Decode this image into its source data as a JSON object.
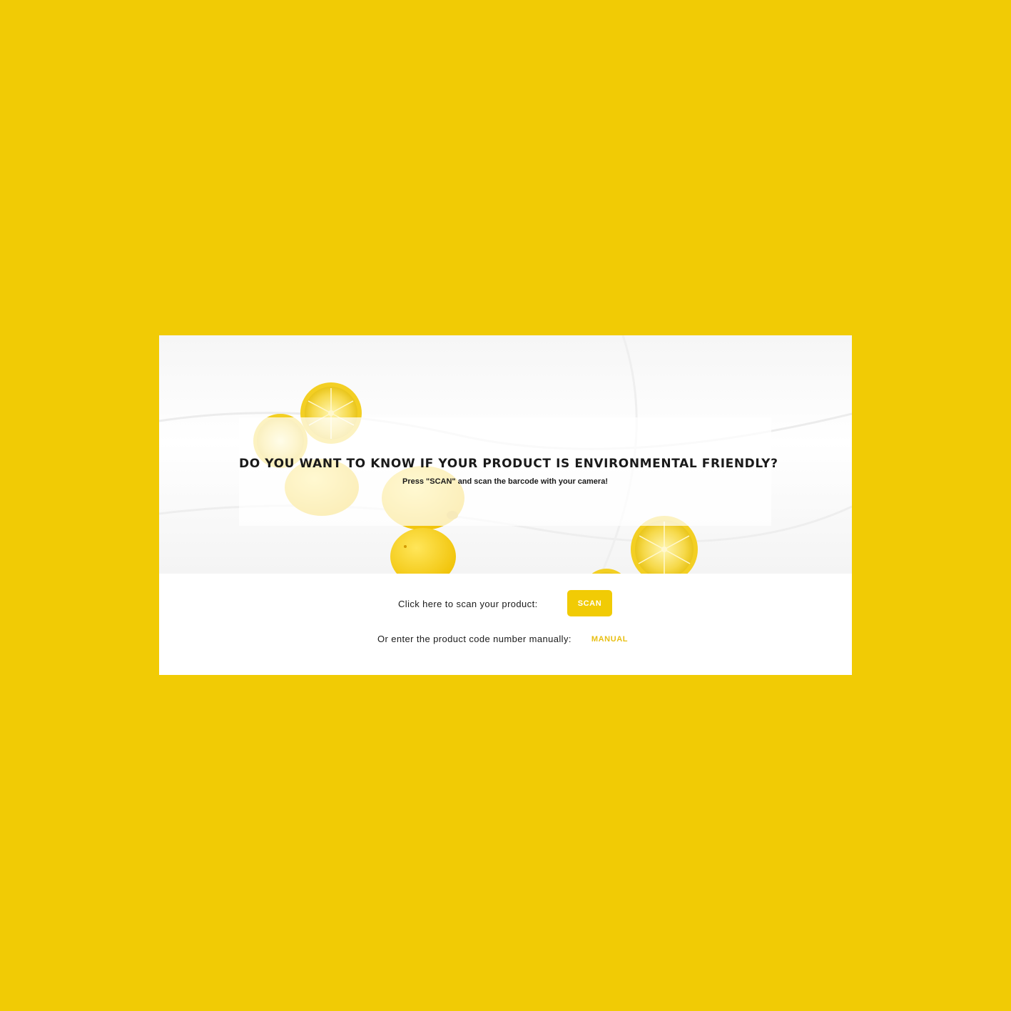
{
  "hero": {
    "title": "DO YOU WANT TO KNOW IF YOUR PRODUCT IS ENVIRONMENTAL FRIENDLY?",
    "subtitle": "Press \"SCAN\" and scan the barcode with your camera!"
  },
  "actions": {
    "scan_prompt": "Click here to scan your product:",
    "scan_label": "SCAN",
    "manual_prompt": "Or enter the product code number manually:",
    "manual_label": "MANUAL"
  },
  "colors": {
    "page_background": "#f1cb05",
    "accent": "#f1cb05",
    "card": "#ffffff",
    "text": "#1a1a1a"
  }
}
